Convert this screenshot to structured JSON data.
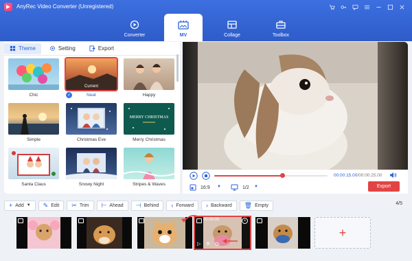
{
  "app": {
    "title": "AnyRec Video Converter (Unregistered)",
    "window_icons": [
      "cart-icon",
      "key-icon",
      "chat-icon",
      "menu-icon",
      "minimize-icon",
      "maximize-icon",
      "close-icon"
    ]
  },
  "nav": {
    "tabs": [
      {
        "label": "Converter",
        "icon": "converter-icon",
        "active": false
      },
      {
        "label": "MV",
        "icon": "mv-icon",
        "active": true
      },
      {
        "label": "Collage",
        "icon": "collage-icon",
        "active": false
      },
      {
        "label": "Toolbox",
        "icon": "toolbox-icon",
        "active": false
      }
    ]
  },
  "panel": {
    "tabs": [
      {
        "label": "Theme",
        "icon": "theme-icon",
        "active": true
      },
      {
        "label": "Setting",
        "icon": "gear-icon",
        "active": false
      },
      {
        "label": "Export",
        "icon": "export-icon",
        "active": false
      }
    ],
    "themes": [
      {
        "label": "Chic",
        "selected": false
      },
      {
        "label": "Neat",
        "selected": true,
        "tag": "Current"
      },
      {
        "label": "Happy",
        "selected": false
      },
      {
        "label": "Simple",
        "selected": false
      },
      {
        "label": "Christmas Eve",
        "selected": false
      },
      {
        "label": "Merry Christmas",
        "selected": false,
        "overlay": "MERRY CHRISTMAS"
      },
      {
        "label": "Santa Claus",
        "selected": false
      },
      {
        "label": "Snowy Night",
        "selected": false
      },
      {
        "label": "Stripes & Waves",
        "selected": false
      }
    ]
  },
  "player": {
    "time_current": "00:00:15.00",
    "time_separator": "/",
    "time_total": "00:00:25.00",
    "progress": 0.6,
    "aspect": "16:9",
    "screen": "1/2",
    "export_label": "Export"
  },
  "toolbar": {
    "add": "Add",
    "edit": "Edit",
    "trim": "Trim",
    "ahead": "Ahead",
    "behind": "Behind",
    "forward": "Forward",
    "backward": "Backward",
    "empty": "Empty",
    "page_current": "4",
    "page_sep": "/",
    "page_total": "5"
  },
  "timeline": {
    "selected_duration": "00:00:05",
    "clip_count": 5,
    "selected_index": 3
  },
  "colors": {
    "brand_blue": "#2c62d8",
    "accent_red": "#e24444"
  }
}
